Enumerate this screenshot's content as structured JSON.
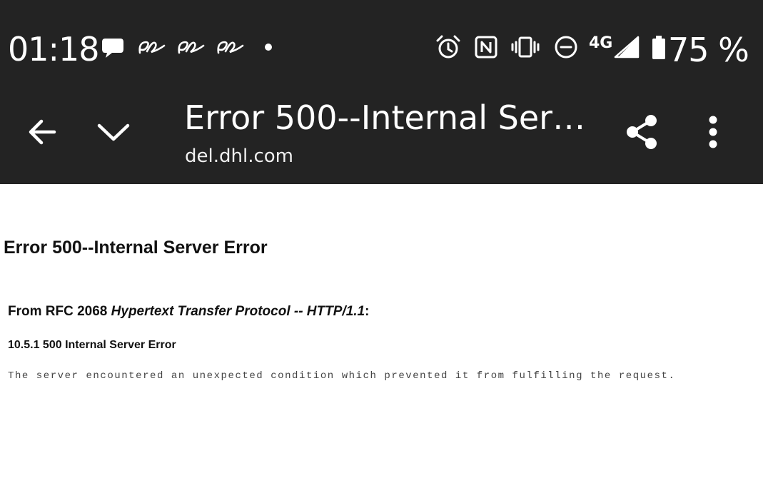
{
  "status_bar": {
    "time": "01:18",
    "notification_icons": [
      "chat-bubble-icon",
      "signature-app-icon",
      "signature-app-icon",
      "signature-app-icon",
      "more-dot-icon"
    ],
    "system_icons": [
      "alarm-icon",
      "nfc-icon",
      "vibrate-icon",
      "do-not-disturb-icon",
      "4g-icon",
      "signal-icon",
      "battery-icon"
    ],
    "network_label": "4G",
    "battery_percent": "75 %"
  },
  "toolbar": {
    "title": "Error 500--Internal Ser…",
    "url": "del.dhl.com",
    "icons": [
      "back-arrow-icon",
      "chevron-down-icon",
      "share-icon",
      "more-vert-icon"
    ]
  },
  "page": {
    "heading": "Error 500--Internal Server Error",
    "from_prefix": "From RFC 2068 ",
    "from_title": "Hypertext Transfer Protocol -- HTTP/1.1",
    "from_suffix": ":",
    "section_heading": "10.5.1 500 Internal Server Error",
    "body_text": "The server encountered an unexpected condition which prevented it from fulfilling the request."
  },
  "colors": {
    "bar_background": "#232323",
    "bar_foreground": "#ffffff",
    "page_background": "#ffffff",
    "body_text": "#444444"
  }
}
